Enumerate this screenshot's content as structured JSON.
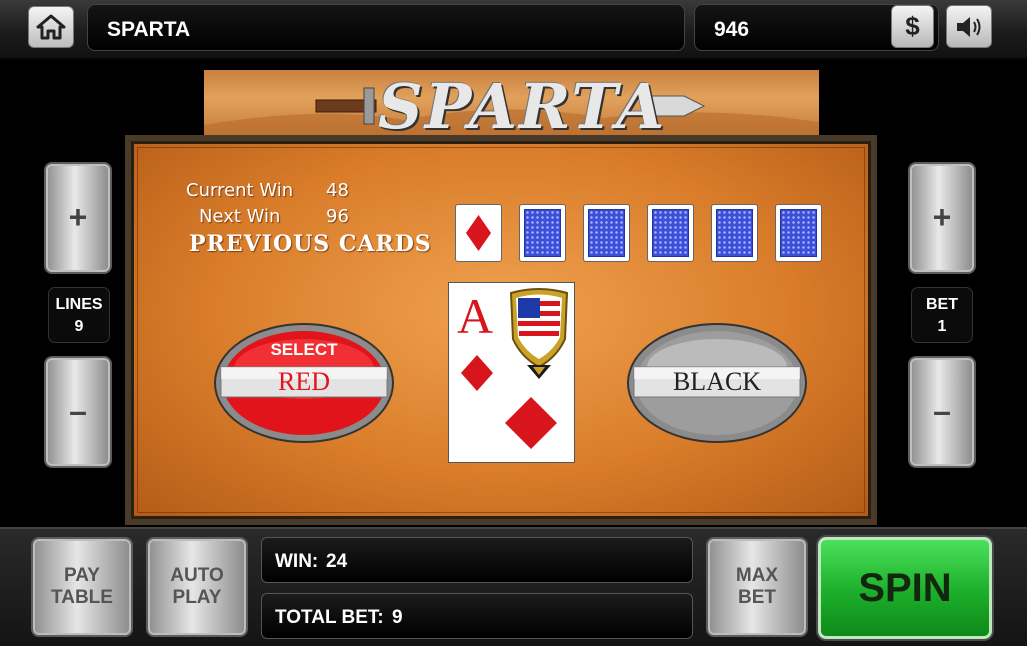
{
  "header": {
    "title": "SPARTA",
    "credits": "946",
    "dollar_label": "$",
    "home_icon": "home-icon",
    "sound_icon": "speaker-icon"
  },
  "banner": {
    "logo_text": "SPARTA"
  },
  "gamble": {
    "current_win_label": "Current Win",
    "current_win_value": "48",
    "next_win_label": "Next Win",
    "next_win_value": "96",
    "previous_cards_label": "PREVIOUS CARDS",
    "previous_cards": [
      "diamond",
      "back",
      "back",
      "back",
      "back",
      "back"
    ],
    "card": {
      "rank": "A",
      "suit": "diamond",
      "suit_color": "#d8141c"
    },
    "select_label": "SELECT",
    "red_label": "RED",
    "black_label": "BLACK"
  },
  "left_controls": {
    "plus": "+",
    "minus": "–",
    "label": "LINES",
    "value": "9"
  },
  "right_controls": {
    "plus": "+",
    "minus": "–",
    "label": "BET",
    "value": "1"
  },
  "footer": {
    "paytable_line1": "PAY",
    "paytable_line2": "TABLE",
    "autoplay_line1": "AUTO",
    "autoplay_line2": "PLAY",
    "win_label": "WIN:",
    "win_value": "24",
    "totalbet_label": "TOTAL BET:",
    "totalbet_value": "9",
    "maxbet_line1": "MAX",
    "maxbet_line2": "BET",
    "spin_label": "SPIN"
  },
  "colors": {
    "red_button": "#e1141c",
    "spin_green": "#1cae2a",
    "card_back_blue": "#3b4fd8",
    "panel_orange": "#d97d2a"
  }
}
